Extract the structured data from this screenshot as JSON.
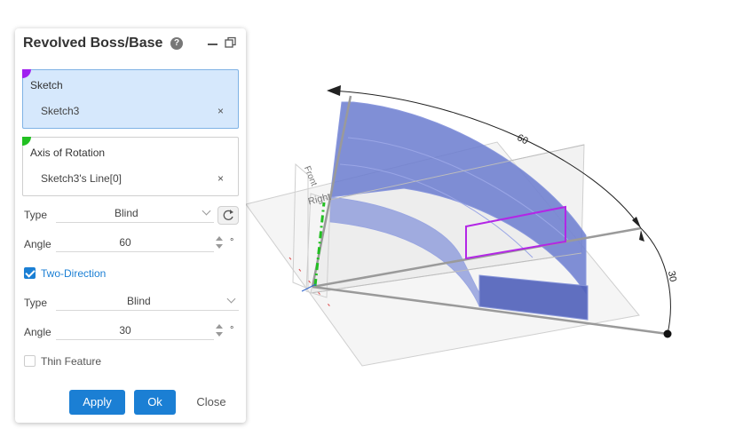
{
  "colors": {
    "accent": "#1b7fd4",
    "body_fill": "#6a7bcf",
    "sketch_marker": "#a020f0",
    "axis_marker": "#22c022",
    "profile_outline": "#b326e6"
  },
  "panel": {
    "title": "Revolved Boss/Base",
    "help_icon": "?",
    "sketch_box": {
      "label": "Sketch",
      "value": "Sketch3",
      "clear": "×"
    },
    "axis_box": {
      "label": "Axis of Rotation",
      "value": "Sketch3's Line[0]",
      "clear": "×"
    },
    "direction1": {
      "type_label": "Type",
      "type_value": "Blind",
      "angle_label": "Angle",
      "angle_value": "60",
      "unit": "°"
    },
    "two_direction": {
      "label": "Two-Direction",
      "checked": true
    },
    "direction2": {
      "type_label": "Type",
      "type_value": "Blind",
      "angle_label": "Angle",
      "angle_value": "30",
      "unit": "°"
    },
    "thin_feature": {
      "label": "Thin Feature",
      "checked": false
    },
    "buttons": {
      "apply": "Apply",
      "ok": "Ok",
      "close": "Close"
    }
  },
  "viewport": {
    "plane_labels": {
      "front": "Front",
      "right": "Right"
    },
    "dimensions": {
      "dir1": "60",
      "dir2": "30"
    }
  }
}
